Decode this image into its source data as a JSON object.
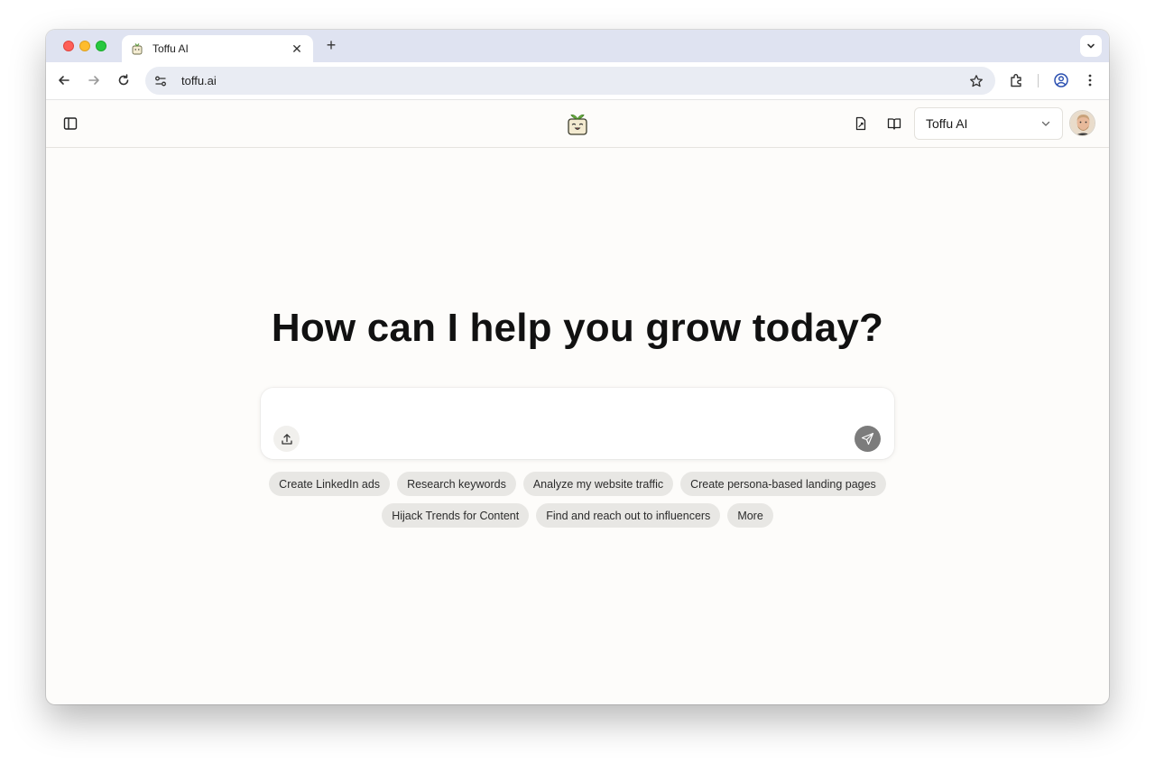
{
  "browser": {
    "tab_title": "Toffu AI",
    "url": "toffu.ai"
  },
  "header": {
    "workspace_selected": "Toffu AI"
  },
  "main": {
    "headline": "How can I help you grow today?",
    "composer_placeholder": "",
    "suggestions_row1": [
      "Create LinkedIn ads",
      "Research keywords",
      "Analyze my website traffic",
      "Create persona-based landing pages"
    ],
    "suggestions_row2": [
      "Hijack Trends for Content",
      "Find and reach out to influencers",
      "More"
    ]
  },
  "colors": {
    "page_background": "#fdfcfa",
    "chip_background": "#e8e7e4",
    "send_button": "#7c7c7c",
    "tabstrip": "#dfe3f1"
  },
  "icons": [
    "favicon-icon",
    "close-icon",
    "plus-icon",
    "chevron-down-icon",
    "back-arrow-icon",
    "forward-arrow-icon",
    "reload-icon",
    "site-settings-icon",
    "star-icon",
    "extensions-icon",
    "profile-icon",
    "more-vert-icon",
    "sidebar-icon",
    "toffu-logo",
    "document-icon",
    "book-icon",
    "upload-icon",
    "send-icon"
  ]
}
